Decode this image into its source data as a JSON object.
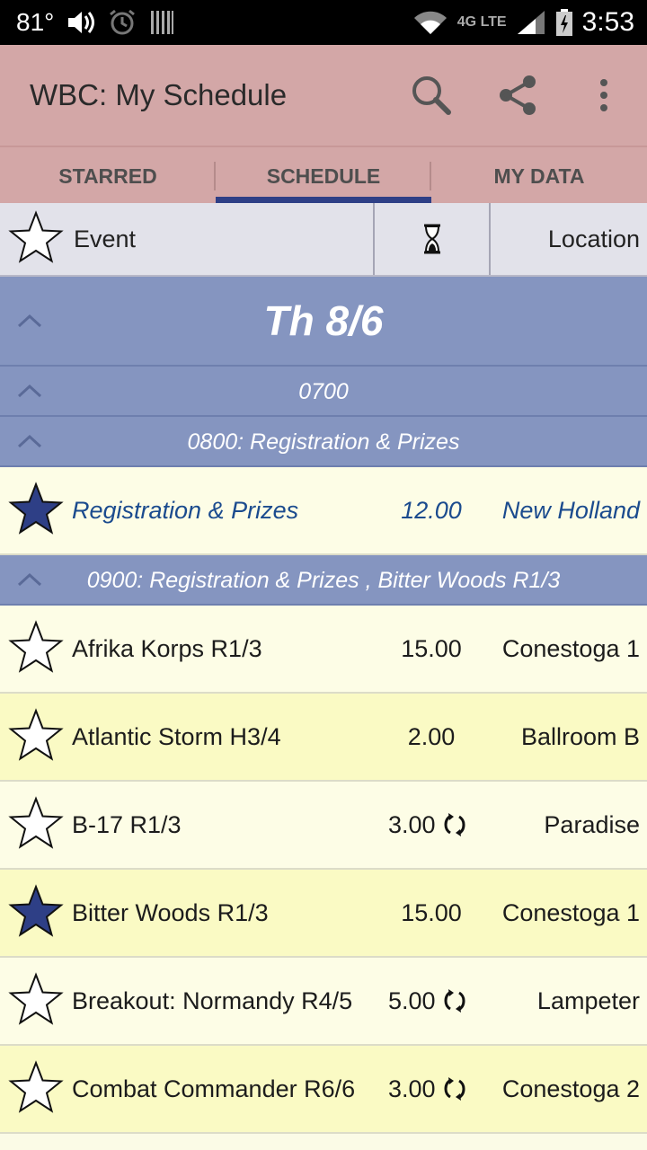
{
  "status_bar": {
    "temperature": "81°",
    "network": "4G LTE",
    "time": "3:53",
    "icons": [
      "volume-icon",
      "alarm-icon",
      "barcode-icon",
      "wifi-icon",
      "signal-icon",
      "battery-icon"
    ]
  },
  "app_bar": {
    "title": "WBC: My Schedule",
    "actions": [
      "search-icon",
      "share-icon",
      "overflow-menu-icon"
    ]
  },
  "tabs": [
    {
      "label": "STARRED",
      "active": false
    },
    {
      "label": "SCHEDULE",
      "active": true
    },
    {
      "label": "MY DATA",
      "active": false
    }
  ],
  "column_headers": {
    "event": "Event",
    "hours_icon": "hourglass-icon",
    "location": "Location"
  },
  "day_header": "Th 8/6",
  "groups": {
    "g0700": "0700",
    "g0800": "0800: Registration & Prizes",
    "g0900": "0900: Registration & Prizes , Bitter Woods R1/3"
  },
  "rows": [
    {
      "name": "Registration & Prizes",
      "duration": "12.00",
      "location": "New Holland",
      "starred": true,
      "highlight": true,
      "continuous": false
    },
    {
      "name": "Afrika Korps R1/3",
      "duration": "15.00",
      "location": "Conestoga 1",
      "starred": false,
      "highlight": false,
      "continuous": false
    },
    {
      "name": "Atlantic Storm H3/4",
      "duration": "2.00",
      "location": "Ballroom B",
      "starred": false,
      "highlight": false,
      "continuous": false
    },
    {
      "name": "B-17 R1/3",
      "duration": "3.00",
      "location": "Paradise",
      "starred": false,
      "highlight": false,
      "continuous": true
    },
    {
      "name": "Bitter Woods R1/3",
      "duration": "15.00",
      "location": "Conestoga 1",
      "starred": true,
      "highlight": false,
      "continuous": false
    },
    {
      "name": "Breakout: Normandy R4/5",
      "duration": "5.00",
      "location": "Lampeter",
      "starred": false,
      "highlight": false,
      "continuous": true
    },
    {
      "name": "Combat Commander R6/6",
      "duration": "3.00",
      "location": "Conestoga 2",
      "starred": false,
      "highlight": false,
      "continuous": true
    }
  ],
  "colors": {
    "app_bar": "#d3a7a7",
    "tab_indicator": "#2e3f86",
    "group_header": "#8595c0",
    "star_filled": "#2e3f86",
    "highlight_text": "#1b4b8e",
    "row_light": "#fdfde6",
    "row_yellow": "#fafac4"
  }
}
